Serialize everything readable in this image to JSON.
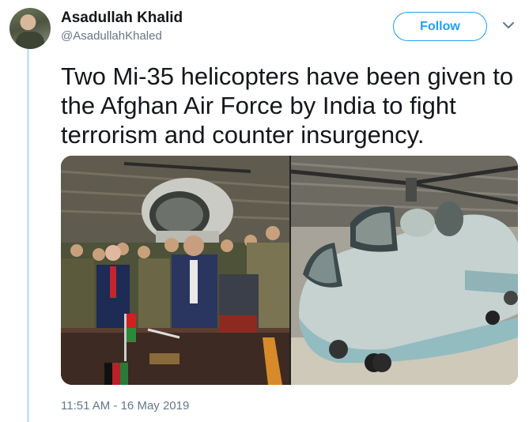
{
  "author": {
    "name": "Asadullah Khalid",
    "handle": "@AsadullahKhaled"
  },
  "follow_button": {
    "label": "Follow"
  },
  "tweet": {
    "text": "Two Mi-35 helicopters have been given to the Afghan Air Force by India to fight terrorism and counter insurgency.",
    "timestamp": "11:51 AM - 16 May 2019"
  },
  "icons": {
    "avatar": "profile-avatar",
    "menu": "chevron-down-icon"
  },
  "colors": {
    "accent": "#1da1f2",
    "secondary_text": "#657786",
    "thread_line": "#c4e3f9"
  }
}
